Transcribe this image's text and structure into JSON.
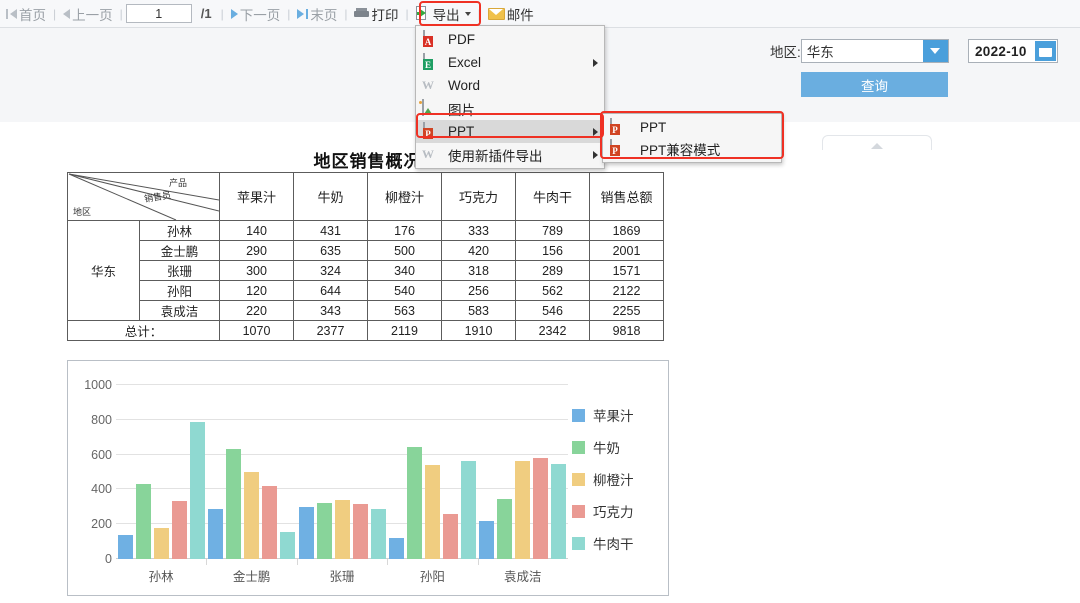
{
  "toolbar": {
    "first_page": "首页",
    "prev_page": "上一页",
    "page_value": "1",
    "page_total": "/1",
    "next_page": "下一页",
    "last_page": "末页",
    "print": "打印",
    "export": "导出",
    "email": "邮件",
    "separator": "|"
  },
  "export_menu": {
    "items": [
      {
        "label": "PDF",
        "icon": "pdf-file-icon",
        "has_submenu": false,
        "active": false
      },
      {
        "label": "Excel",
        "icon": "excel-file-icon",
        "has_submenu": true,
        "active": false
      },
      {
        "label": "Word",
        "icon": "word-file-icon",
        "has_submenu": false,
        "active": false
      },
      {
        "label": "图片",
        "icon": "image-file-icon",
        "has_submenu": false,
        "active": false
      },
      {
        "label": "PPT",
        "icon": "ppt-file-icon",
        "has_submenu": true,
        "active": true
      },
      {
        "label": "使用新插件导出",
        "icon": "word-file-icon",
        "has_submenu": true,
        "active": false
      }
    ],
    "submenu": {
      "items": [
        {
          "label": "PPT",
          "icon": "ppt-file-icon"
        },
        {
          "label": "PPT兼容模式",
          "icon": "ppt-file-icon"
        }
      ]
    },
    "highlight_color": "#ef3124"
  },
  "filter": {
    "region_label": "地区:",
    "region_value": "华东",
    "date_value": "2022-10",
    "query_button": "查询",
    "accent_color": "#6aaee0"
  },
  "report": {
    "title": "地区销售概况",
    "table": {
      "corner": {
        "product": "产品",
        "salesperson": "销售员",
        "region": "地区"
      },
      "columns": [
        "苹果汁",
        "牛奶",
        "柳橙汁",
        "巧克力",
        "牛肉干",
        "销售总额"
      ],
      "region_name": "华东",
      "rows": [
        {
          "person": "孙林",
          "values": [
            140,
            431,
            176,
            333,
            789,
            1869
          ]
        },
        {
          "person": "金士鹏",
          "values": [
            290,
            635,
            500,
            420,
            156,
            2001
          ]
        },
        {
          "person": "张珊",
          "values": [
            300,
            324,
            340,
            318,
            289,
            1571
          ]
        },
        {
          "person": "孙阳",
          "values": [
            120,
            644,
            540,
            256,
            562,
            2122
          ]
        },
        {
          "person": "袁成洁",
          "values": [
            220,
            343,
            563,
            583,
            546,
            2255
          ]
        }
      ],
      "total_label": "总计：",
      "totals": [
        1070,
        2377,
        2119,
        1910,
        2342,
        9818
      ]
    }
  },
  "chart_data": {
    "type": "bar",
    "title": "",
    "xlabel": "",
    "ylabel": "",
    "categories": [
      "孙林",
      "金士鹏",
      "张珊",
      "孙阳",
      "袁成洁"
    ],
    "series": [
      {
        "name": "苹果汁",
        "color": "#6fb0e3",
        "values": [
          140,
          290,
          300,
          120,
          220
        ]
      },
      {
        "name": "牛奶",
        "color": "#88d49a",
        "values": [
          431,
          635,
          324,
          644,
          343
        ]
      },
      {
        "name": "柳橙汁",
        "color": "#f0cd80",
        "values": [
          176,
          500,
          340,
          540,
          563
        ]
      },
      {
        "name": "巧克力",
        "color": "#ea9a93",
        "values": [
          333,
          420,
          318,
          256,
          583
        ]
      },
      {
        "name": "牛肉干",
        "color": "#8fd9d1",
        "values": [
          789,
          156,
          289,
          562,
          546
        ]
      }
    ],
    "ylim": [
      0,
      1000
    ],
    "yticks": [
      0,
      200,
      400,
      600,
      800,
      1000
    ],
    "grid": true,
    "legend_position": "right"
  }
}
